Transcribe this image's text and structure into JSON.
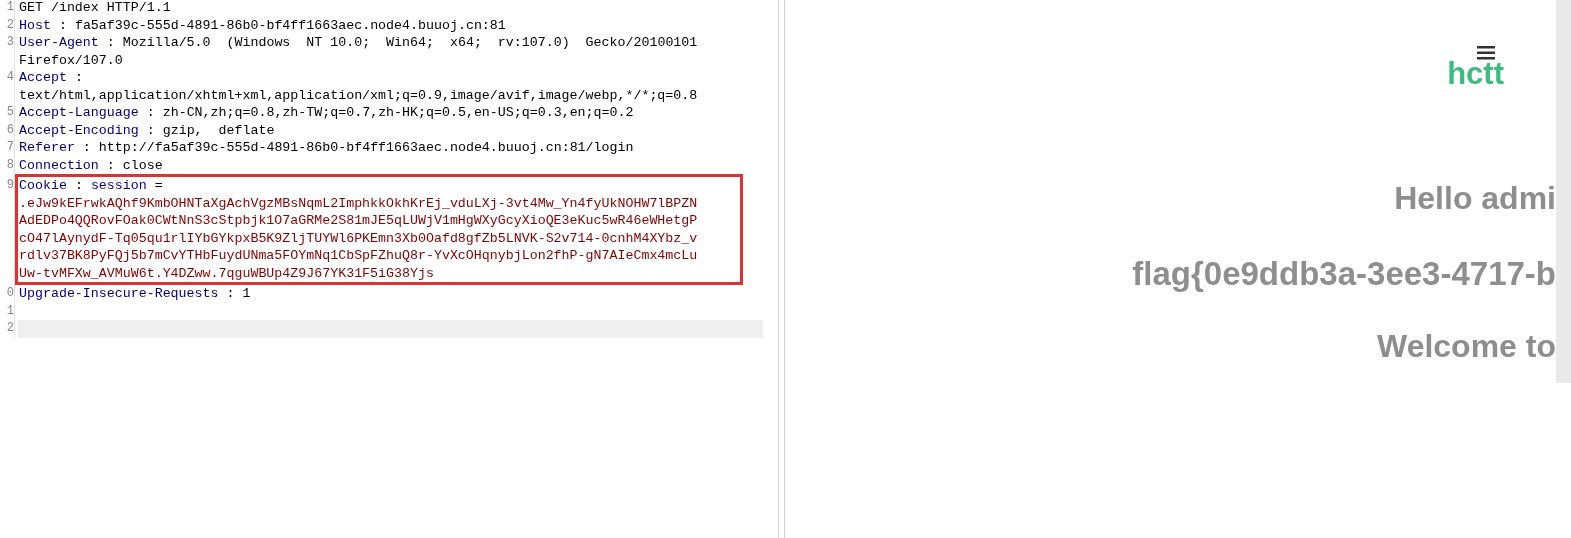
{
  "request_editor": {
    "lines": [
      {
        "number": "1",
        "kind": "request_line",
        "text": "GET /index HTTP/1.1",
        "highlighted": false,
        "current": false
      },
      {
        "number": "2",
        "kind": "header",
        "name": "Host",
        "separator": ":",
        "value_lines": [
          "fa5af39c-555d-4891-86b0-bf4ff1663aec.node4.buuoj.cn:81"
        ],
        "value_on_next_line": false,
        "highlighted": false,
        "current": false
      },
      {
        "number": "3",
        "kind": "header",
        "name": "User-Agent",
        "separator": ":",
        "value_lines": [
          "Mozilla/5.0  (Windows  NT 10.0;  Win64;  x64;  rv:107.0)  Gecko/20100101",
          "Firefox/107.0"
        ],
        "value_on_next_line": false,
        "highlighted": false,
        "current": false
      },
      {
        "number": "4",
        "kind": "header",
        "name": "Accept",
        "separator": ":",
        "value_lines": [
          "text/html,application/xhtml+xml,application/xml;q=0.9,image/avif,image/webp,*/*;q=0.8"
        ],
        "value_on_next_line": true,
        "highlighted": false,
        "current": false
      },
      {
        "number": "5",
        "kind": "header",
        "name": "Accept-Language",
        "separator": ":",
        "value_lines": [
          "zh-CN,zh;q=0.8,zh-TW;q=0.7,zh-HK;q=0.5,en-US;q=0.3,en;q=0.2"
        ],
        "value_on_next_line": false,
        "highlighted": false,
        "current": false
      },
      {
        "number": "6",
        "kind": "header",
        "name": "Accept-Encoding",
        "separator": ":",
        "value_lines": [
          "gzip,  deflate"
        ],
        "value_on_next_line": false,
        "highlighted": false,
        "current": false
      },
      {
        "number": "7",
        "kind": "header",
        "name": "Referer",
        "separator": ":",
        "value_lines": [
          "http://fa5af39c-555d-4891-86b0-bf4ff1663aec.node4.buuoj.cn:81/login"
        ],
        "value_on_next_line": false,
        "highlighted": false,
        "current": false
      },
      {
        "number": "8",
        "kind": "header",
        "name": "Connection",
        "separator": ":",
        "value_lines": [
          "close"
        ],
        "value_on_next_line": false,
        "highlighted": false,
        "current": false
      },
      {
        "number": "9",
        "kind": "cookie",
        "name": "Cookie",
        "separator": ":",
        "cookie_name": "session",
        "equals": "=",
        "value_lines": [
          ".eJw9kEFrwkAQhf9KmbOHNTaXgAchVgzMBsNqmL2ImphkkOkhKrEj_vduLXj-3vt4Mw_Yn4fyUkNOHW7lBPZN",
          "AdEDPo4QQRovFOak0CWtNnS3cStpbjk1O7aGRMe2S81mJE5qLUWjV1mHgWXyGcyXioQE3eKuc5wR46eWHetgP",
          "cO47lAynydF-Tq05qu1rlIYbGYkpxB5K9ZljTUYWl6PKEmn3Xb0Oafd8gfZb5LNVK-S2v714-0cnhM4XYbz_v",
          "rdlv37BK8PyFQj5b7mCvYTHbFuydUNma5FOYmNq1CbSpFZhuQ8r-YvXcOHqnybjLon2fhP-gN7AIeCmx4mcLu",
          "Uw-tvMFXw_AVMuW6t.Y4DZww.7qguWBUp4Z9J67YK31F5iG38Yjs"
        ],
        "value_on_next_line": true,
        "highlighted": true,
        "current": false
      },
      {
        "number": "0",
        "kind": "header",
        "name": "Upgrade-Insecure-Requests",
        "separator": ":",
        "value_lines": [
          "1"
        ],
        "value_on_next_line": false,
        "highlighted": false,
        "current": false
      },
      {
        "number": "1",
        "kind": "blank",
        "highlighted": false,
        "current": false
      },
      {
        "number": "2",
        "kind": "blank",
        "highlighted": false,
        "current": true
      }
    ]
  },
  "response_view": {
    "logo": "hctt",
    "messages": [
      "Hello admi",
      "flag{0e9ddb3a-3ee3-4717-b",
      "Welcome to"
    ]
  }
}
